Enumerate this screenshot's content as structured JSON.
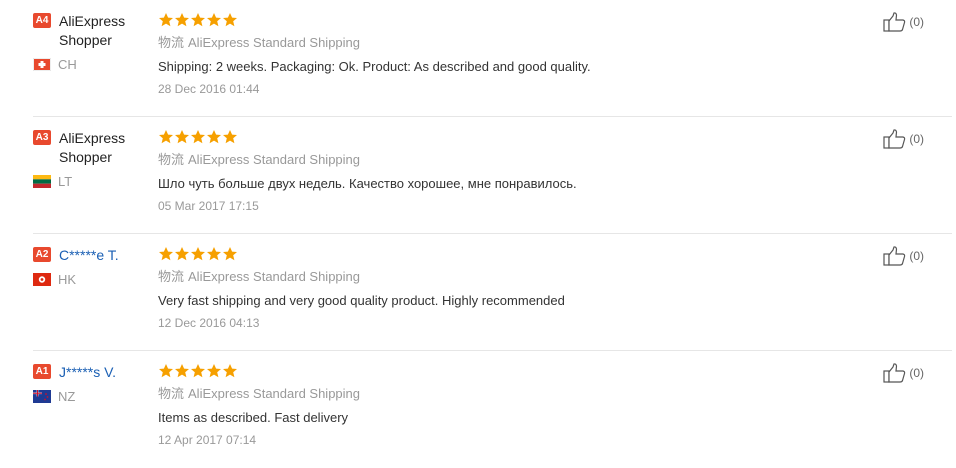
{
  "reviews": [
    {
      "level": "A4",
      "name": "AliExpress Shopper",
      "country": "CH",
      "flag": "ch",
      "rating": 5,
      "shipping_cn": "物流",
      "shipping": "AliExpress Standard Shipping",
      "text": "Shipping: 2 weeks. Packaging: Ok. Product: As described and good quality.",
      "date": "28 Dec 2016 01:44",
      "helpful": "(0)"
    },
    {
      "level": "A3",
      "name": "AliExpress Shopper",
      "country": "LT",
      "flag": "lt",
      "rating": 5,
      "shipping_cn": "物流",
      "shipping": "AliExpress Standard Shipping",
      "text": "Шло чуть больше двух недель. Качество хорошее, мне понравилось.",
      "date": "05 Mar 2017 17:15",
      "helpful": "(0)"
    },
    {
      "level": "A2",
      "name": "C*****e T.",
      "country": "HK",
      "flag": "hk",
      "rating": 5,
      "shipping_cn": "物流",
      "shipping": "AliExpress Standard Shipping",
      "text": "Very fast shipping and very good quality product. Highly recommended",
      "date": "12 Dec 2016 04:13",
      "helpful": "(0)"
    },
    {
      "level": "A1",
      "name": "J*****s V.",
      "country": "NZ",
      "flag": "nz",
      "rating": 5,
      "shipping_cn": "物流",
      "shipping": "AliExpress Standard Shipping",
      "text": "Items as described. Fast delivery",
      "date": "12 Apr 2017 07:14",
      "helpful": "(0)"
    }
  ],
  "colors": {
    "star": "#f6a000",
    "level_badge": "#e8492e",
    "link": "#1a5fb4"
  }
}
